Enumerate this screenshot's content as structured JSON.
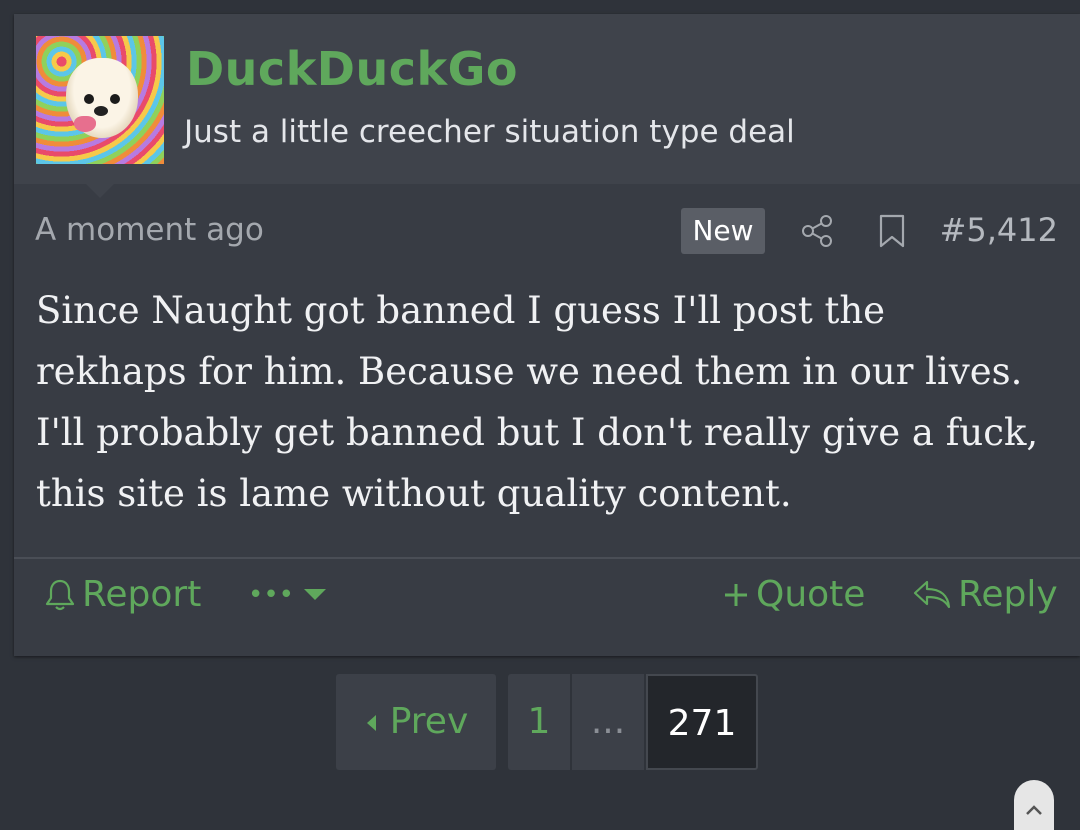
{
  "user": {
    "name": "DuckDuckGo",
    "title": "Just a little creecher situation type deal"
  },
  "post": {
    "timestamp": "A moment ago",
    "badge": "New",
    "number": "#5,412",
    "message": "Since Naught got banned I guess I'll post the rekhaps for him. Because we need them in our lives. I'll probably get banned but I don't really give a fuck, this site is lame without quality content."
  },
  "actions": {
    "report": "Report",
    "more": "•••",
    "quote": "Quote",
    "reply": "Reply"
  },
  "pagination": {
    "prev": "Prev",
    "first": "1",
    "ellipsis": "...",
    "current": "271"
  },
  "colors": {
    "accent": "#5fa85c",
    "background": "#2f333a",
    "card": "#383c44",
    "header": "#3f434b"
  }
}
